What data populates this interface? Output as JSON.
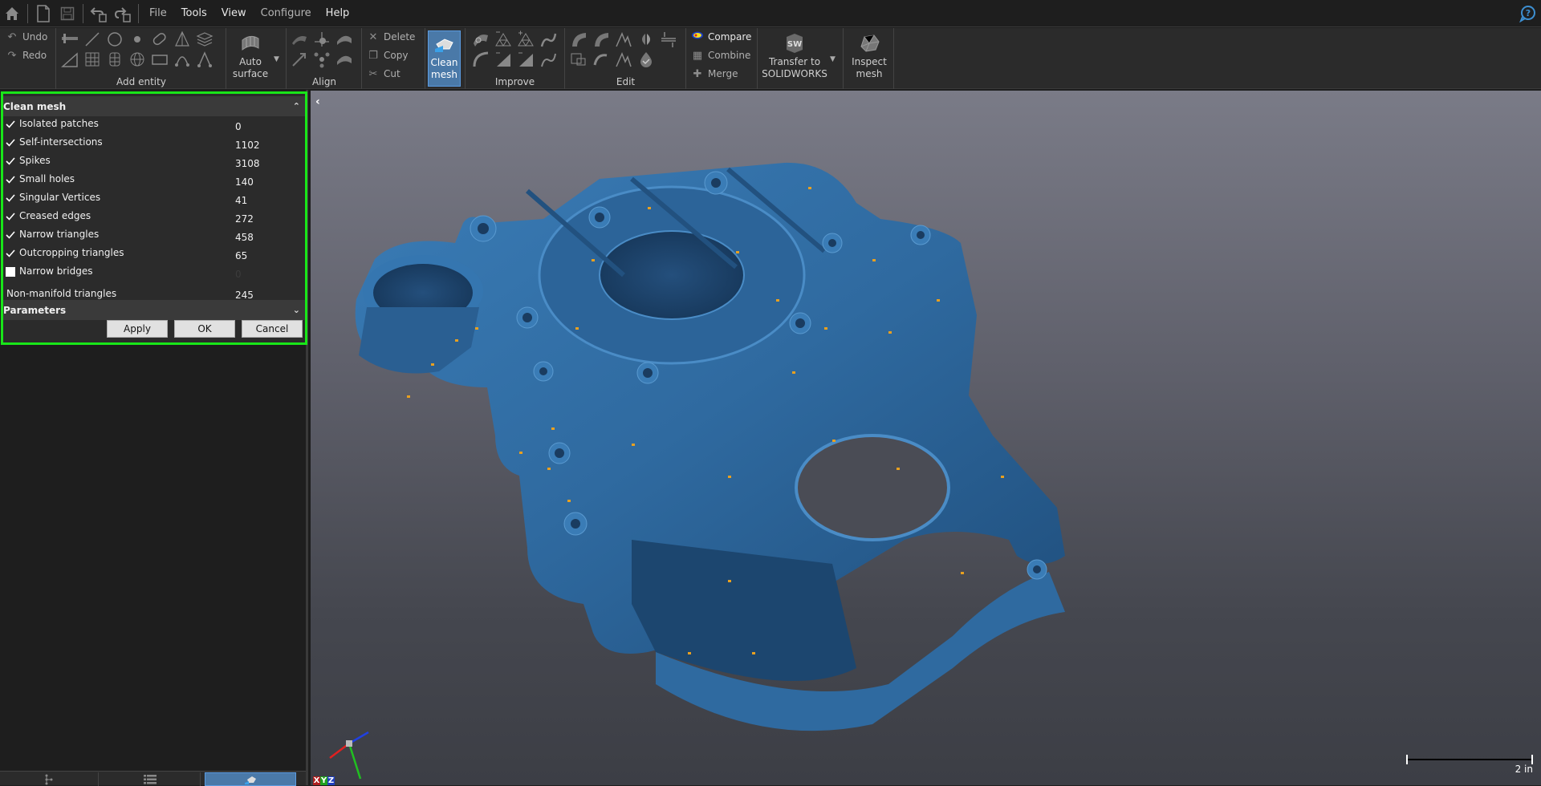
{
  "menubar": {
    "quick_access": [
      {
        "name": "home-icon"
      },
      {
        "name": "new-file-icon"
      },
      {
        "name": "save-icon"
      },
      {
        "name": "undo-history-icon"
      },
      {
        "name": "redo-history-icon"
      }
    ],
    "menus": [
      {
        "label": "File",
        "dim": true
      },
      {
        "label": "Tools",
        "dim": false
      },
      {
        "label": "View",
        "dim": false
      },
      {
        "label": "Configure",
        "dim": true
      },
      {
        "label": "Help",
        "dim": false
      }
    ],
    "help_icon": "help-chat-icon"
  },
  "ribbon": {
    "undo_label": "Undo",
    "redo_label": "Redo",
    "groups": {
      "add_entity": "Add entity",
      "align": "Align",
      "improve": "Improve",
      "edit": "Edit"
    },
    "auto_surface": {
      "line1": "Auto",
      "line2": "surface"
    },
    "delete_label": "Delete",
    "copy_label": "Copy",
    "cut_label": "Cut",
    "clean_mesh": {
      "line1": "Clean",
      "line2": "mesh",
      "active": true
    },
    "compare_label": "Compare",
    "combine_label": "Combine",
    "merge_label": "Merge",
    "transfer": {
      "line1": "Transfer to",
      "line2": "SOLIDWORKS"
    },
    "inspect": {
      "line1": "Inspect",
      "line2": "mesh"
    }
  },
  "panel": {
    "title": "Clean mesh",
    "rows": [
      {
        "label": "Isolated patches",
        "value": "0",
        "checked": true
      },
      {
        "label": "Self-intersections",
        "value": "1102",
        "checked": true
      },
      {
        "label": "Spikes",
        "value": "3108",
        "checked": true
      },
      {
        "label": "Small holes",
        "value": "140",
        "checked": true
      },
      {
        "label": "Singular Vertices",
        "value": "41",
        "checked": true
      },
      {
        "label": "Creased edges",
        "value": "272",
        "checked": true
      },
      {
        "label": "Narrow triangles",
        "value": "458",
        "checked": true
      },
      {
        "label": "Outcropping triangles",
        "value": "65",
        "checked": true
      },
      {
        "label": "Narrow bridges",
        "value": "0",
        "checked": false
      }
    ],
    "non_manifold": {
      "label": "Non-manifold triangles",
      "value": "245"
    },
    "parameters_title": "Parameters",
    "apply_label": "Apply",
    "ok_label": "OK",
    "cancel_label": "Cancel"
  },
  "bottom_tabs": [
    {
      "name": "tree-tab",
      "active": false
    },
    {
      "name": "list-tab",
      "active": false
    },
    {
      "name": "tools-tab",
      "active": true
    }
  ],
  "viewport": {
    "scale_label": "2 in",
    "axis_labels": [
      "X",
      "Y",
      "Z"
    ],
    "mesh_color": "#2f6aa0",
    "defect_color": "#e8a020"
  },
  "colors": {
    "accent": "#4a79a8",
    "highlight_border": "#19e619"
  }
}
